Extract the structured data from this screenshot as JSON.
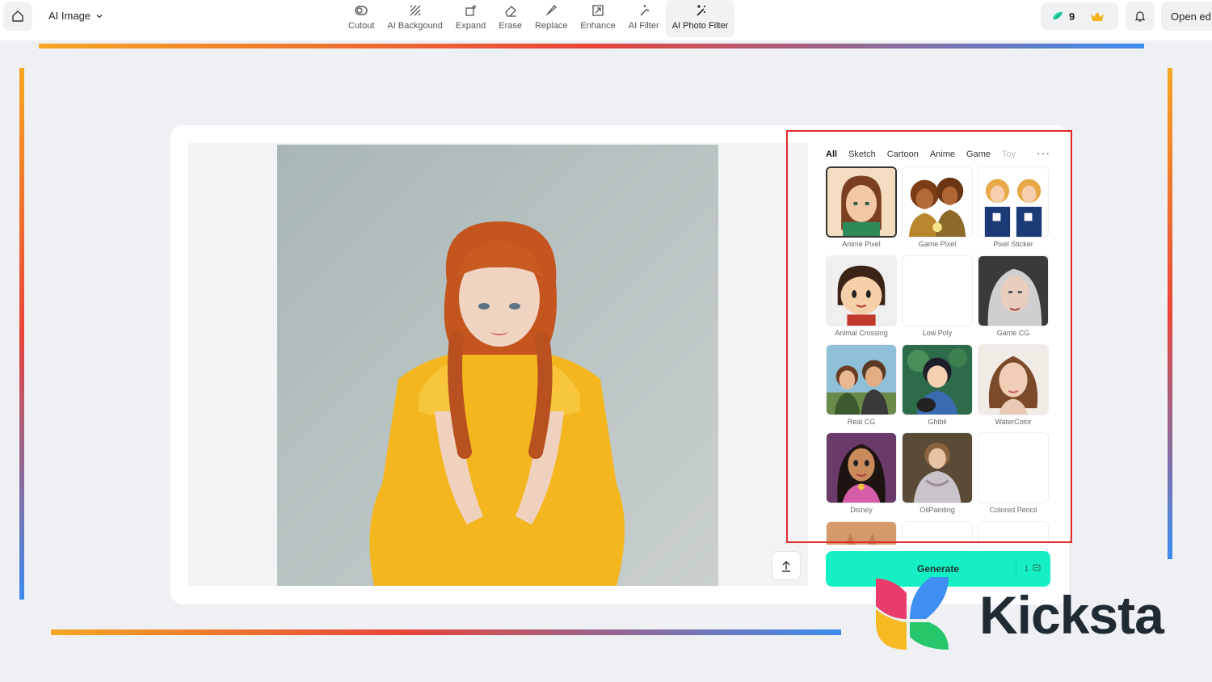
{
  "topbar": {
    "app_menu": {
      "label": "AI Image",
      "icon": "chevron-down-icon"
    },
    "tools": [
      {
        "label": "Cutout",
        "icon": "cutout-icon"
      },
      {
        "label": "AI Backgound",
        "icon": "background-icon"
      },
      {
        "label": "Expand",
        "icon": "expand-icon"
      },
      {
        "label": "Erase",
        "icon": "eraser-icon"
      },
      {
        "label": "Replace",
        "icon": "replace-icon"
      },
      {
        "label": "Enhance",
        "icon": "enhance-icon"
      },
      {
        "label": "AI Filter",
        "icon": "magic-wand-icon"
      },
      {
        "label": "AI Photo Filter",
        "icon": "magic-wand-icon",
        "active": true
      }
    ],
    "credits": "9",
    "open_label": "Open ed"
  },
  "filter_panel": {
    "tabs": [
      {
        "label": "All",
        "active": true
      },
      {
        "label": "Sketch"
      },
      {
        "label": "Cartoon"
      },
      {
        "label": "Anime"
      },
      {
        "label": "Game"
      },
      {
        "label": "Toy"
      }
    ],
    "items": [
      {
        "label": "Anime Pixel",
        "selected": true
      },
      {
        "label": "Game Pixel"
      },
      {
        "label": "Pixel Sticker"
      },
      {
        "label": "Animal Crossing"
      },
      {
        "label": "Low Poly"
      },
      {
        "label": "Game CG"
      },
      {
        "label": "Real CG"
      },
      {
        "label": "Ghibli"
      },
      {
        "label": "WaterColor"
      },
      {
        "label": "Disney"
      },
      {
        "label": "OilPainting"
      },
      {
        "label": "Colored Pencil"
      }
    ],
    "generate_label": "Generate",
    "generate_cost": "1"
  },
  "brand": {
    "name": "Kicksta"
  },
  "colors": {
    "accent": "#14f0c4",
    "highlight": "#e02b2b",
    "gradient_start": "#f5a623",
    "gradient_mid": "#e8443a",
    "gradient_end": "#3b8cf0"
  }
}
